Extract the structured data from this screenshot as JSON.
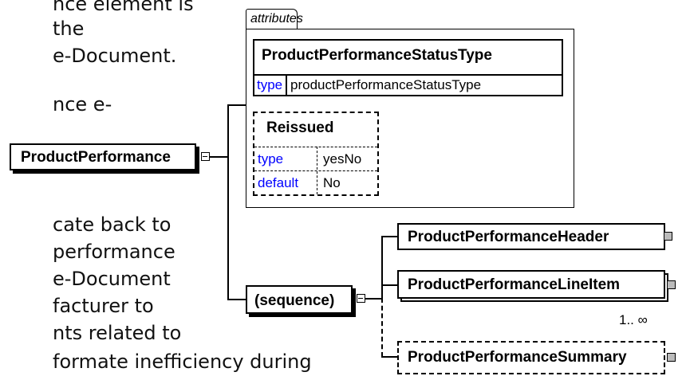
{
  "doc_text": [
    "nce element is",
    "the",
    "e-Document.",
    "nce e-",
    "cate back to",
    "performance",
    "e-Document",
    "facturer to",
    "nts related to",
    "formate inefficiency during"
  ],
  "diagram": {
    "root": "ProductPerformance",
    "attributes_tab": "attributes",
    "attr1": {
      "name": "ProductPerformanceStatusType",
      "type_label": "type",
      "type_value": "productPerformanceStatusType"
    },
    "attr2": {
      "name": "Reissued",
      "type_label": "type",
      "type_value": "yesNo",
      "default_label": "default",
      "default_value": "No"
    },
    "sequence": "(sequence)",
    "children": [
      {
        "name": "ProductPerformanceHeader"
      },
      {
        "name": "ProductPerformanceLineItem",
        "cardinality": "1.. ∞"
      },
      {
        "name": "ProductPerformanceSummary"
      }
    ]
  }
}
